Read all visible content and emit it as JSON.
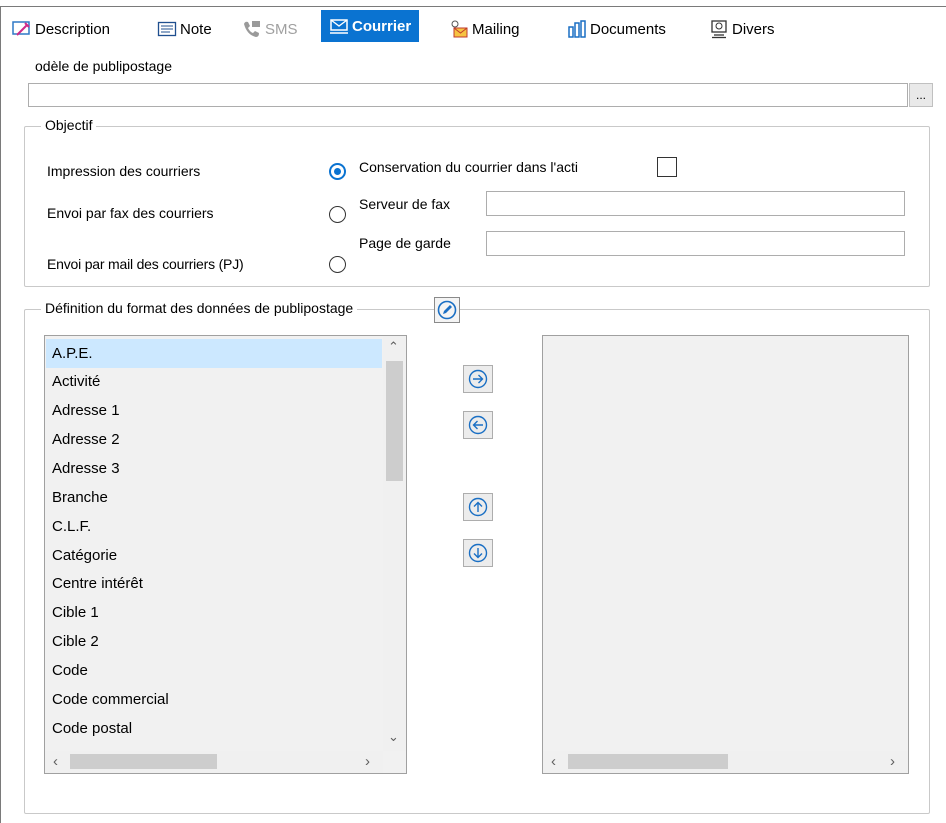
{
  "tabs": [
    {
      "label": "Description",
      "icon": "description-icon"
    },
    {
      "label": "Note",
      "icon": "note-icon"
    },
    {
      "label": "SMS",
      "icon": "phone-icon",
      "disabled": true
    },
    {
      "label": "Courrier",
      "icon": "mail-icon",
      "active": true
    },
    {
      "label": "Mailing",
      "icon": "mailing-icon"
    },
    {
      "label": "Documents",
      "icon": "documents-icon"
    },
    {
      "label": "Divers",
      "icon": "divers-icon"
    }
  ],
  "template": {
    "label": "odèle de publipostage",
    "value": "",
    "browse_label": "..."
  },
  "objectif": {
    "title": "Objectif",
    "options": [
      {
        "label": "Impression des courriers",
        "selected": true
      },
      {
        "label": "Envoi par fax des courriers",
        "selected": false
      },
      {
        "label": "Envoi par mail des courriers (PJ)",
        "selected": false
      }
    ],
    "conservation_label": "Conservation du courrier dans l'acti",
    "conservation_checked": false,
    "fax_server_label": "Serveur de fax",
    "fax_server_value": "",
    "cover_page_label": "Page de garde",
    "cover_page_value": ""
  },
  "format": {
    "title": "Définition du format des données de publipostage",
    "available_fields": [
      "A.P.E.",
      "Activité",
      "Adresse 1",
      "Adresse 2",
      "Adresse 3",
      "Branche",
      "C.L.F.",
      "Catégorie",
      "Centre intérêt",
      "Cible 1",
      "Cible 2",
      "Code",
      "Code commercial",
      "Code postal"
    ],
    "selected_item": "A.P.E.",
    "selected_fields": []
  },
  "colors": {
    "accent": "#0a73d1",
    "selection": "#cce8ff"
  }
}
